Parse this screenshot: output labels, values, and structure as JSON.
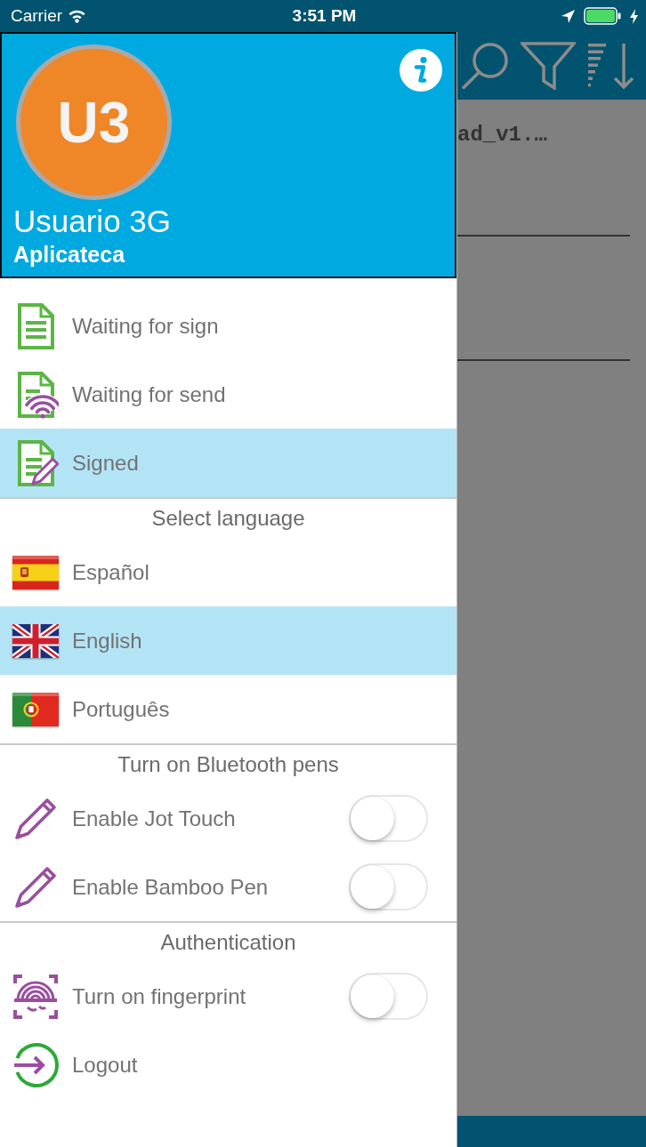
{
  "status_bar": {
    "carrier": "Carrier",
    "time": "3:51 PM"
  },
  "background_screen": {
    "list_item_title": "ad_v1.…"
  },
  "drawer": {
    "avatar_initials": "U3",
    "user_name": "Usuario 3G",
    "organization": "Aplicateca",
    "menu": [
      {
        "label": "Waiting for sign",
        "selected": false
      },
      {
        "label": "Waiting for send",
        "selected": false
      },
      {
        "label": "Signed",
        "selected": true
      }
    ],
    "language_section": {
      "title": "Select language",
      "languages": [
        {
          "label": "Español",
          "selected": false
        },
        {
          "label": "English",
          "selected": true
        },
        {
          "label": "Português",
          "selected": false
        }
      ]
    },
    "pens_section": {
      "title": "Turn on Bluetooth pens",
      "pens": [
        {
          "label": "Enable Jot Touch",
          "on": false
        },
        {
          "label": "Enable Bamboo Pen",
          "on": false
        }
      ]
    },
    "auth_section": {
      "title": "Authentication",
      "items": [
        {
          "kind": "toggle",
          "label": "Turn on fingerprint",
          "on": false
        },
        {
          "kind": "action",
          "label": "Logout"
        }
      ]
    }
  }
}
